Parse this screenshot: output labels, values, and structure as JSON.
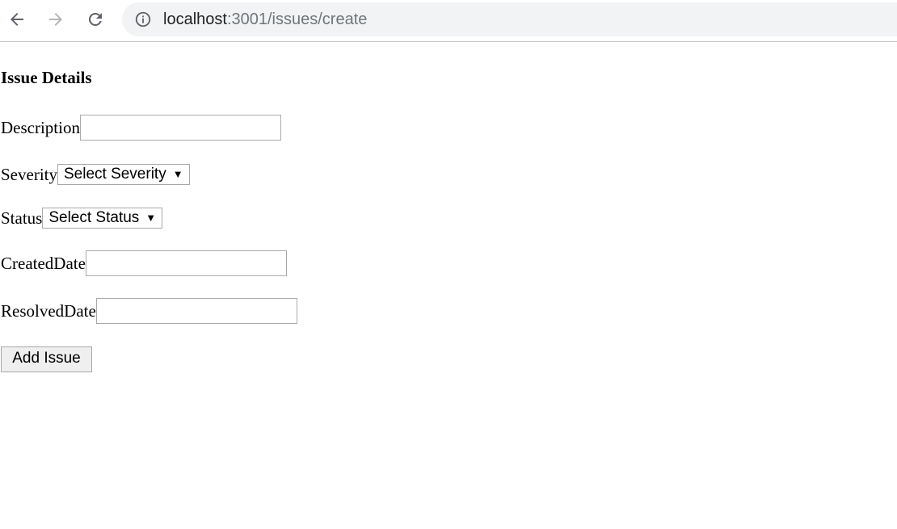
{
  "browser": {
    "url_host": "localhost",
    "url_path": ":3001/issues/create",
    "icons": {
      "back": "arrow-left-icon",
      "forward": "arrow-right-icon",
      "reload": "reload-icon",
      "site_info": "info-icon"
    }
  },
  "form": {
    "title": "Issue Details",
    "description_label": "Description",
    "description_value": "",
    "severity_label": "Severity",
    "severity_selected": "Select Severity",
    "status_label": "Status",
    "status_selected": "Select Status",
    "created_label": "CreatedDate",
    "created_value": "",
    "resolved_label": "ResolvedDate",
    "resolved_value": "",
    "submit_label": "Add Issue"
  }
}
